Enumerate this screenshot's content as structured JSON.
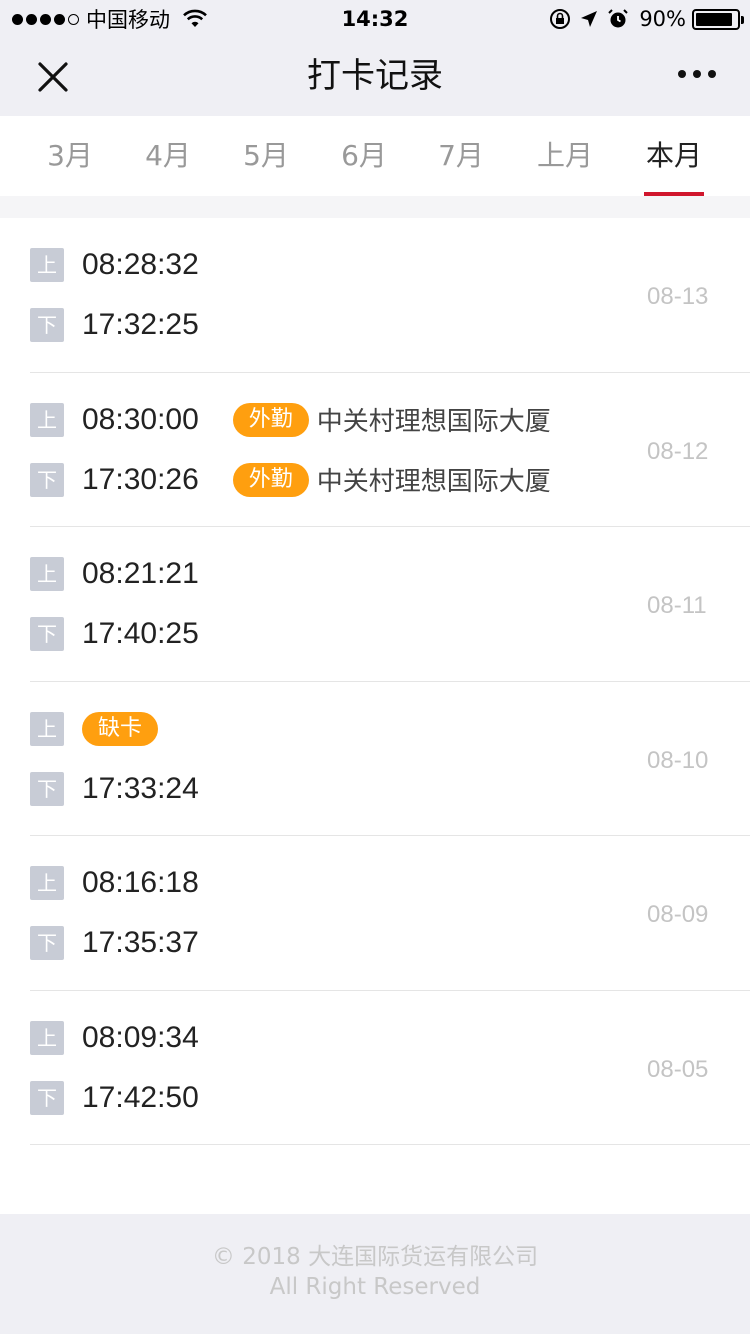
{
  "status_bar": {
    "carrier": "中国移动",
    "time": "14:32",
    "battery": "90%",
    "battery_level": 0.9,
    "icons": [
      "signal-dots",
      "wifi-icon",
      "orientation-lock-icon",
      "location-icon",
      "alarm-icon",
      "battery-icon"
    ]
  },
  "nav": {
    "title": "打卡记录",
    "close_icon": "close-icon",
    "more_icon": "more-icon"
  },
  "tabs": [
    {
      "label": "3月",
      "active": false
    },
    {
      "label": "4月",
      "active": false
    },
    {
      "label": "5月",
      "active": false
    },
    {
      "label": "6月",
      "active": false
    },
    {
      "label": "7月",
      "active": false
    },
    {
      "label": "上月",
      "active": false
    },
    {
      "label": "本月",
      "active": true
    }
  ],
  "accent_color": "#d0162d",
  "badge_color": "#ff9f0f",
  "shift_tags": {
    "in": "上",
    "out": "下"
  },
  "records": [
    {
      "date": "08-13",
      "in": {
        "time": "08:28:32"
      },
      "out": {
        "time": "17:32:25"
      }
    },
    {
      "date": "08-12",
      "in": {
        "time": "08:30:00",
        "badge": "外勤",
        "location": "中关村理想国际大厦"
      },
      "out": {
        "time": "17:30:26",
        "badge": "外勤",
        "location": "中关村理想国际大厦"
      }
    },
    {
      "date": "08-11",
      "in": {
        "time": "08:21:21"
      },
      "out": {
        "time": "17:40:25"
      }
    },
    {
      "date": "08-10",
      "in": {
        "missing": "缺卡"
      },
      "out": {
        "time": "17:33:24"
      }
    },
    {
      "date": "08-09",
      "in": {
        "time": "08:16:18"
      },
      "out": {
        "time": "17:35:37"
      }
    },
    {
      "date": "08-05",
      "in": {
        "time": "08:09:34"
      },
      "out": {
        "time": "17:42:50"
      }
    }
  ],
  "footer": {
    "line1": "© 2018 大连国际货运有限公司",
    "line2": "All Right Reserved"
  }
}
